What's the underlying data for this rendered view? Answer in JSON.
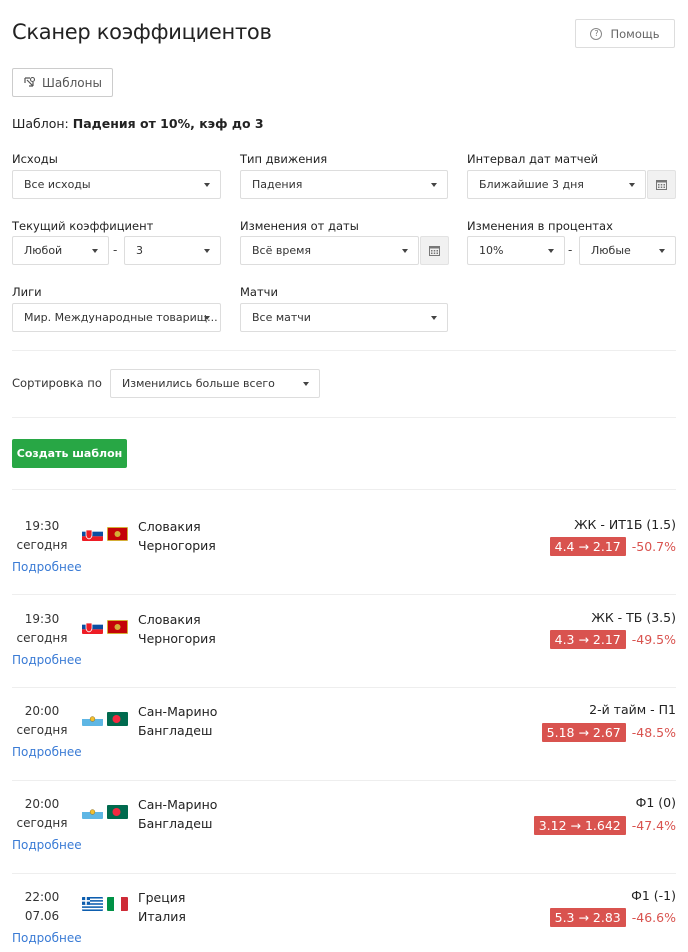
{
  "header": {
    "title": "Сканер коэффициентов",
    "help_label": "Помощь",
    "help_icon": "question-circle-icon"
  },
  "templates_button": {
    "label": "Шаблоны",
    "icon": "templates-icon"
  },
  "template_line": {
    "prefix": "Шаблон:",
    "name": "Падения от 10%, кэф до 3"
  },
  "filters": {
    "outcomes": {
      "label": "Исходы",
      "value": "Все исходы"
    },
    "movement": {
      "label": "Тип движения",
      "value": "Падения"
    },
    "date_range": {
      "label": "Интервал дат матчей",
      "value": "Ближайшие 3 дня"
    },
    "current_coef": {
      "label": "Текущий коэффициент",
      "from": "Любой",
      "to": "3",
      "dash": "-"
    },
    "changes_from": {
      "label": "Изменения от даты",
      "value": "Всё время"
    },
    "changes_pct": {
      "label": "Изменения в процентах",
      "from": "10%",
      "to": "Любые",
      "dash": "-"
    },
    "leagues": {
      "label": "Лиги",
      "value": "Мир. Международные товарищ..."
    },
    "matches": {
      "label": "Матчи",
      "value": "Все матчи"
    }
  },
  "sort": {
    "label": "Сортировка по",
    "value": "Изменились больше всего"
  },
  "create_button": {
    "label": "Создать шаблон"
  },
  "events": [
    {
      "time": "19:30",
      "day": "сегодня",
      "more": "Подробнее",
      "home": "Словакия",
      "away": "Черногория",
      "market": "ЖК - ИТ1Б (1.5)",
      "odds": "4.4 → 2.17",
      "pct": "-50.7%"
    },
    {
      "time": "19:30",
      "day": "сегодня",
      "more": "Подробнее",
      "home": "Словакия",
      "away": "Черногория",
      "market": "ЖК - ТБ (3.5)",
      "odds": "4.3 → 2.17",
      "pct": "-49.5%"
    },
    {
      "time": "20:00",
      "day": "сегодня",
      "more": "Подробнее",
      "home": "Сан-Марино",
      "away": "Бангладеш",
      "market": "2-й тайм - П1",
      "odds": "5.18 → 2.67",
      "pct": "-48.5%"
    },
    {
      "time": "20:00",
      "day": "сегодня",
      "more": "Подробнее",
      "home": "Сан-Марино",
      "away": "Бангладеш",
      "market": "Ф1 (0)",
      "odds": "3.12 → 1.642",
      "pct": "-47.4%"
    },
    {
      "time": "22:00",
      "day": "07.06",
      "more": "Подробнее",
      "home": "Греция",
      "away": "Италия",
      "market": "Ф1 (-1)",
      "odds": "5.3 → 2.83",
      "pct": "-46.6%"
    }
  ],
  "colors": {
    "accent_green": "#28a745",
    "drop_red": "#d9534f",
    "link_blue": "#3a7bd5"
  }
}
